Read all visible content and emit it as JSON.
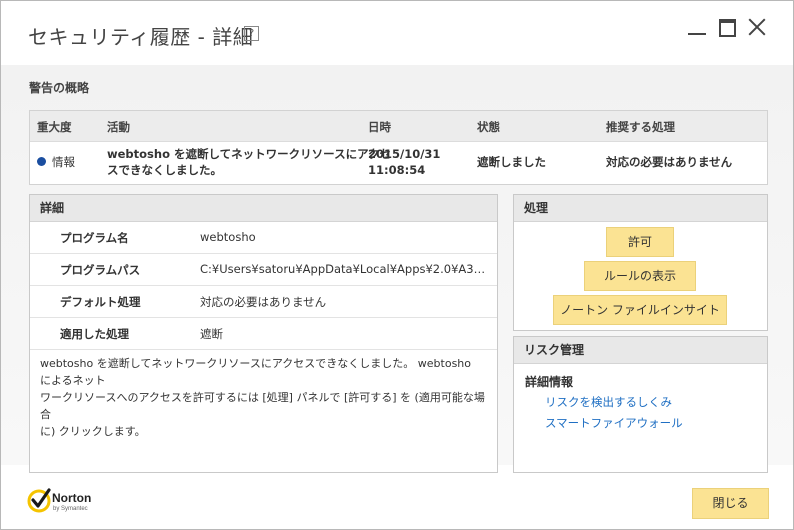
{
  "window": {
    "title": "セキュリティ履歴 - 詳細",
    "help": "?"
  },
  "summary": {
    "label": "警告の概略",
    "columns": [
      "重大度",
      "活動",
      "日時",
      "状態",
      "推奨する処理"
    ],
    "row": {
      "severity": "情報",
      "activity_bold": "webtosho",
      "activity_line1": "webtosho を遮断してネットワークリソースにアクセ",
      "activity_line2": "スできなくしました。",
      "date": "2015/10/31",
      "time": "11:08:54",
      "status": "遮断しました",
      "recommended": "対応の必要はありません"
    },
    "severity_color": "#1a4ea0"
  },
  "details": {
    "heading": "詳細",
    "rows": [
      {
        "label": "プログラム名",
        "value": "webtosho"
      },
      {
        "label": "プログラムパス",
        "value": "C:¥Users¥satoru¥AppData¥Local¥Apps¥2.0¥A3DZCP..."
      },
      {
        "label": "デフォルト処理",
        "value": "対応の必要はありません"
      },
      {
        "label": "適用した処理",
        "value": "遮断"
      }
    ],
    "description_line1": "webtosho を遮断してネットワークリソースにアクセスできなくしました。 webtosho によるネット",
    "description_line2": "ワークリソースへのアクセスを許可するには [処理] パネルで [許可する] を (適用可能な場合",
    "description_line3": "に) クリックします。"
  },
  "actions": {
    "heading": "処理",
    "allow": "許可",
    "show_rules": "ルールの表示",
    "insight": "ノートン ファイルインサイト"
  },
  "risk": {
    "heading": "リスク管理",
    "subheading": "詳細情報",
    "link1": "リスクを検出するしくみ",
    "link2": "スマートファイアウォール"
  },
  "footer": {
    "brand": "Norton",
    "brand_sub": "by Symantec",
    "close": "閉じる"
  },
  "colors": {
    "accent_button": "#fbe393",
    "link": "#1f6fc3",
    "brand_check": "#f5c400"
  }
}
